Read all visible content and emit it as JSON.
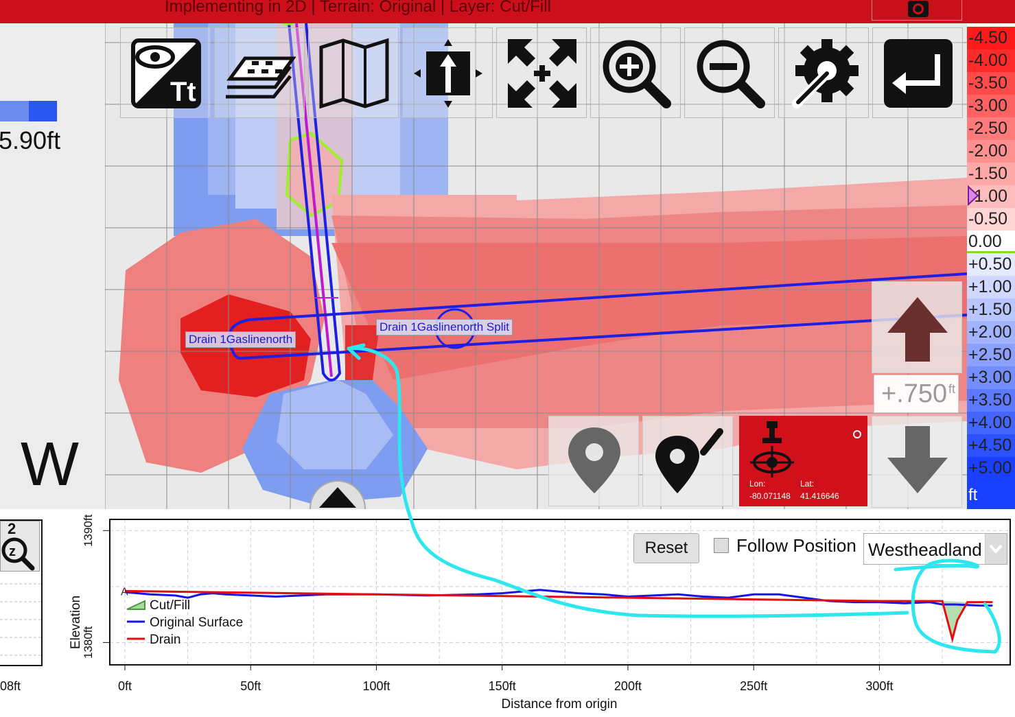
{
  "window": {
    "title": "Implementing in 2D | Terrain: Original | Layer: Cut/Fill"
  },
  "left_panel": {
    "depth_readout": "5.90ft",
    "compass": "W"
  },
  "toolbar": {
    "buttons": [
      {
        "name": "view-text-toggle-button",
        "icon": "eye-text-icon"
      },
      {
        "name": "layers-button",
        "icon": "layers-icon"
      },
      {
        "name": "map-button",
        "icon": "map-icon"
      },
      {
        "name": "north-up-button",
        "icon": "north-arrow-icon"
      },
      {
        "name": "fit-extent-button",
        "icon": "expand-arrows-icon"
      },
      {
        "name": "zoom-in-button",
        "icon": "zoom-in-icon"
      },
      {
        "name": "zoom-out-button",
        "icon": "zoom-out-icon"
      },
      {
        "name": "settings-button",
        "icon": "gear-wrench-icon"
      },
      {
        "name": "return-button",
        "icon": "return-arrow-icon"
      }
    ]
  },
  "map": {
    "labels": {
      "drain_left": "Drain 1Gaslinenorth",
      "drain_split": "Drain 1Gaslinenorth Split"
    }
  },
  "legend": {
    "items": [
      {
        "label": "-4.50",
        "color": "#ff1b1b"
      },
      {
        "label": "-4.00",
        "color": "#ff2b2b"
      },
      {
        "label": "-3.50",
        "color": "#ff4a4a"
      },
      {
        "label": "-3.00",
        "color": "#ff6262"
      },
      {
        "label": "-2.50",
        "color": "#ff7a7a"
      },
      {
        "label": "-2.00",
        "color": "#ff9090"
      },
      {
        "label": "-1.50",
        "color": "#ffa8a8"
      },
      {
        "label": "-1.00",
        "color": "#ffbcbc"
      },
      {
        "label": "-0.50",
        "color": "#ffd4d4"
      },
      {
        "label": "0.00",
        "color": "#ffffff"
      },
      {
        "label": "+0.50",
        "color": "#e6eaff"
      },
      {
        "label": "+1.00",
        "color": "#d0d8ff"
      },
      {
        "label": "+1.50",
        "color": "#bac6ff"
      },
      {
        "label": "+2.00",
        "color": "#a3b4ff"
      },
      {
        "label": "+2.50",
        "color": "#8ca1ff"
      },
      {
        "label": "+3.00",
        "color": "#748dff"
      },
      {
        "label": "+3.50",
        "color": "#5c79ff"
      },
      {
        "label": "+4.00",
        "color": "#4465ff"
      },
      {
        "label": "+4.50",
        "color": "#2c51ff"
      },
      {
        "label": "+5.00",
        "color": "#1a40ff"
      }
    ],
    "unit": "ft"
  },
  "elevation_control": {
    "step_value": "+.750",
    "step_unit": "ft"
  },
  "gps": {
    "lon_label": "Lon:",
    "lat_label": "Lat:",
    "lon_value": "-80.071148",
    "lat_value": "41.416646"
  },
  "mini_chart": {
    "zoom_level": "2",
    "tick_label": "08ft"
  },
  "profile": {
    "reset_label": "Reset",
    "follow_label": "Follow Position",
    "follow_checked": false,
    "route_selected": "Westheadland"
  },
  "chart_data": {
    "type": "line",
    "title": "",
    "xlabel": "Distance from origin",
    "ylabel": "Elevation",
    "xlim": [
      -6,
      352
    ],
    "ylim": [
      1378,
      1391
    ],
    "x_ticks": [
      {
        "value": 0,
        "label": "0ft"
      },
      {
        "value": 50,
        "label": "50ft"
      },
      {
        "value": 100,
        "label": "100ft"
      },
      {
        "value": 150,
        "label": "150ft"
      },
      {
        "value": 200,
        "label": "200ft"
      },
      {
        "value": 250,
        "label": "250ft"
      },
      {
        "value": 300,
        "label": "300ft"
      }
    ],
    "y_ticks": [
      {
        "value": 1380,
        "label": "1380ft"
      },
      {
        "value": 1390,
        "label": "1390ft"
      }
    ],
    "start_marker": "A",
    "grid": true,
    "legend_position": "bottom-left",
    "legend": [
      "Cut/Fill",
      "Original Surface",
      "Drain"
    ],
    "series": [
      {
        "name": "Original Surface",
        "color": "#1515e6",
        "x": [
          0,
          10,
          20,
          25,
          30,
          35,
          40,
          50,
          60,
          70,
          80,
          100,
          120,
          140,
          150,
          160,
          165,
          170,
          180,
          190,
          200,
          210,
          220,
          230,
          240,
          250,
          260,
          270,
          280,
          290,
          300,
          310,
          320,
          325,
          330,
          340,
          345
        ],
        "y": [
          1384.5,
          1384.3,
          1384.2,
          1384.0,
          1384.3,
          1384.4,
          1384.3,
          1384.2,
          1384.1,
          1384.2,
          1384.3,
          1384.3,
          1384.2,
          1384.3,
          1384.4,
          1384.6,
          1384.7,
          1384.6,
          1384.4,
          1384.3,
          1384.1,
          1384.2,
          1384.3,
          1384.1,
          1384.0,
          1384.3,
          1384.3,
          1384.0,
          1383.7,
          1383.6,
          1383.6,
          1383.5,
          1383.6,
          1383.4,
          1383.4,
          1383.3,
          1383.3
        ]
      },
      {
        "name": "Drain",
        "color": "#e01010",
        "x": [
          0,
          100,
          200,
          300,
          325,
          327,
          329,
          331,
          335,
          345
        ],
        "y": [
          1384.6,
          1384.3,
          1384.0,
          1383.7,
          1383.7,
          1382.0,
          1380.3,
          1382.0,
          1383.6,
          1383.6
        ]
      }
    ]
  }
}
